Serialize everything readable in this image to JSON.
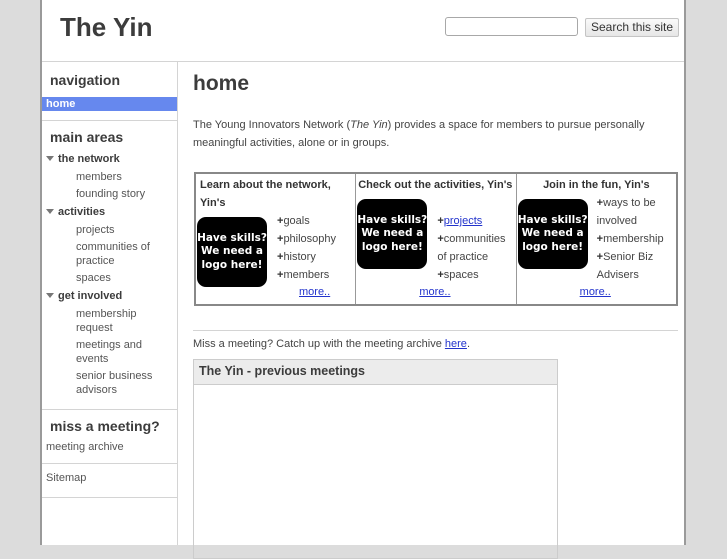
{
  "header": {
    "site_title": "The Yin",
    "search_placeholder": "",
    "search_button": "Search this site"
  },
  "sidebar": {
    "navigation": {
      "heading": "navigation",
      "home": "home"
    },
    "main_areas": {
      "heading": "main areas",
      "groups": [
        {
          "label": "the network",
          "items": [
            "members",
            "founding story"
          ]
        },
        {
          "label": "activities",
          "items": [
            "projects",
            "communities of practice",
            "spaces"
          ]
        },
        {
          "label": "get involved",
          "items": [
            "membership request",
            "meetings and events",
            "senior business advisors"
          ]
        }
      ]
    },
    "miss_meeting": {
      "heading": "miss a meeting?",
      "link": "meeting archive"
    },
    "sitemap": "Sitemap"
  },
  "main": {
    "heading": "home",
    "intro_before": "The Young Innovators Network (",
    "intro_em": "The Yin",
    "intro_after": ") provides a space for members to pursue personally meaningful activities, alone or in groups.",
    "logo_text": "Have skills? We need a logo here!",
    "boxes": [
      {
        "title": "Learn about the network, Yin's",
        "items": [
          "goals",
          "philosophy",
          "history",
          "members"
        ],
        "more": "more.."
      },
      {
        "title": "Check out the activities, Yin's",
        "items": [
          "projects",
          "communities of practice",
          "spaces"
        ],
        "more": "more.."
      },
      {
        "title": "Join in the fun, Yin's",
        "items": [
          "ways to be involved",
          "membership",
          "Senior Biz Advisers"
        ],
        "more": "more.."
      }
    ],
    "archive_text": "Miss a meeting? Catch up with the meeting archive ",
    "archive_link": "here",
    "archive_end": ".",
    "meetings_title": "The Yin - previous meetings"
  }
}
